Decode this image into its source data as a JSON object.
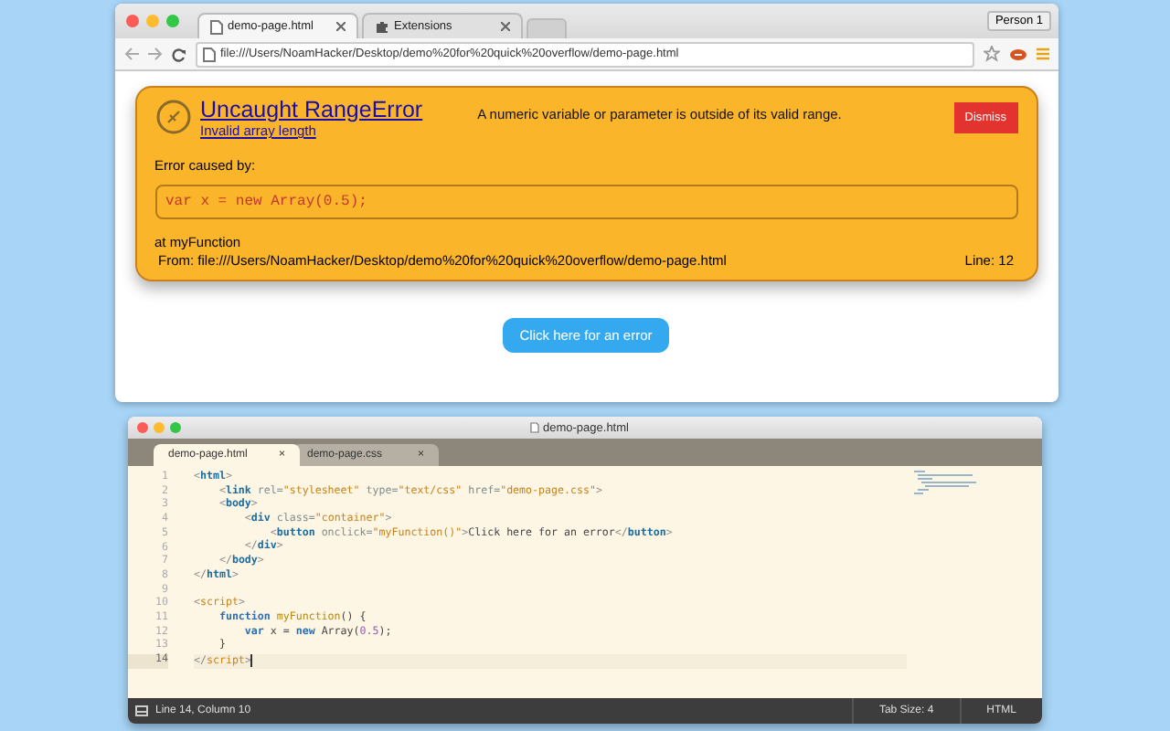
{
  "browser": {
    "tabs": [
      {
        "label": "demo-page.html",
        "selected": true
      },
      {
        "label": "Extensions",
        "selected": false
      }
    ],
    "profile": "Person 1",
    "address": "file:///Users/NoamHacker/Desktop/demo%20for%20quick%20overflow/demo-page.html",
    "error_card": {
      "title": "Uncaught RangeError",
      "subtitle": "Invalid array length",
      "description": "A numeric variable or parameter is outside of its valid range.",
      "dismiss": "Dismiss",
      "caused_label": "Error caused by:",
      "code": "var x = new Array(0.5);",
      "function": "at myFunction",
      "source": "From: file:///Users/NoamHacker/Desktop/demo%20for%20quick%20overflow/demo-page.html",
      "line": "Line: 12"
    },
    "page_button": "Click here for an error"
  },
  "editor": {
    "title": "demo-page.html",
    "tabs": [
      {
        "label": "demo-page.html",
        "close": "×",
        "selected": true
      },
      {
        "label": "demo-page.css",
        "close": "×",
        "selected": false
      }
    ],
    "lines": [
      {
        "number": "1",
        "current": false,
        "tokens": [
          {
            "kind": "punct",
            "text": "<"
          },
          {
            "kind": "tag",
            "text": "html"
          },
          {
            "kind": "punct",
            "text": ">"
          }
        ]
      },
      {
        "number": "2",
        "current": false,
        "tokens": [
          {
            "kind": "punct",
            "text": "    <"
          },
          {
            "kind": "tag",
            "text": "link"
          },
          {
            "kind": "attr",
            "text": " rel="
          },
          {
            "kind": "string",
            "text": "\"stylesheet\""
          },
          {
            "kind": "attr",
            "text": " type="
          },
          {
            "kind": "string",
            "text": "\"text/css\""
          },
          {
            "kind": "attr",
            "text": " href="
          },
          {
            "kind": "string",
            "text": "\"demo-page.css\""
          },
          {
            "kind": "punct",
            "text": ">"
          }
        ]
      },
      {
        "number": "3",
        "current": false,
        "tokens": [
          {
            "kind": "punct",
            "text": "    <"
          },
          {
            "kind": "tag",
            "text": "body"
          },
          {
            "kind": "punct",
            "text": ">"
          }
        ]
      },
      {
        "number": "4",
        "current": false,
        "tokens": [
          {
            "kind": "punct",
            "text": "        <"
          },
          {
            "kind": "tag",
            "text": "div"
          },
          {
            "kind": "attr",
            "text": " class="
          },
          {
            "kind": "string",
            "text": "\"container\""
          },
          {
            "kind": "punct",
            "text": ">"
          }
        ]
      },
      {
        "number": "5",
        "current": false,
        "tokens": [
          {
            "kind": "punct",
            "text": "            <"
          },
          {
            "kind": "tag",
            "text": "button"
          },
          {
            "kind": "attr",
            "text": " onclick="
          },
          {
            "kind": "string",
            "text": "\"myFunction()\""
          },
          {
            "kind": "punct",
            "text": ">"
          },
          {
            "kind": "text",
            "text": "Click here for an error"
          },
          {
            "kind": "punct",
            "text": "</"
          },
          {
            "kind": "tag",
            "text": "button"
          },
          {
            "kind": "punct",
            "text": ">"
          }
        ]
      },
      {
        "number": "6",
        "current": false,
        "tokens": [
          {
            "kind": "punct",
            "text": "        </"
          },
          {
            "kind": "tag",
            "text": "div"
          },
          {
            "kind": "punct",
            "text": ">"
          }
        ]
      },
      {
        "number": "7",
        "current": false,
        "tokens": [
          {
            "kind": "punct",
            "text": "    </"
          },
          {
            "kind": "tag",
            "text": "body"
          },
          {
            "kind": "punct",
            "text": ">"
          }
        ]
      },
      {
        "number": "8",
        "current": false,
        "tokens": [
          {
            "kind": "punct",
            "text": "</"
          },
          {
            "kind": "tag",
            "text": "html"
          },
          {
            "kind": "punct",
            "text": ">"
          }
        ]
      },
      {
        "number": "9",
        "current": false
      },
      {
        "number": "10",
        "current": false,
        "tokens": [
          {
            "kind": "punct",
            "text": "<"
          },
          {
            "kind": "string",
            "text": "script"
          },
          {
            "kind": "punct",
            "text": ">"
          }
        ]
      },
      {
        "number": "11",
        "current": false,
        "tokens": [
          {
            "kind": "keyword",
            "text": "    function"
          },
          {
            "kind": "func",
            "text": " myFunction"
          },
          {
            "kind": "text",
            "text": "() {"
          }
        ]
      },
      {
        "number": "12",
        "current": false,
        "tokens": [
          {
            "kind": "keyword",
            "text": "        var"
          },
          {
            "kind": "text",
            "text": " x = "
          },
          {
            "kind": "keyword",
            "text": "new"
          },
          {
            "kind": "text",
            "text": " Array("
          },
          {
            "kind": "number",
            "text": "0.5"
          },
          {
            "kind": "text",
            "text": ");"
          }
        ]
      },
      {
        "number": "13",
        "current": false,
        "tokens": [
          {
            "kind": "text",
            "text": "    }"
          }
        ]
      },
      {
        "number": "14",
        "current": true,
        "tokens": [
          {
            "kind": "punct",
            "text": "</"
          },
          {
            "kind": "string",
            "text": "script"
          },
          {
            "kind": "punct",
            "text": ">"
          }
        ]
      }
    ],
    "status": {
      "position": "Line 14, Column 10",
      "tab_size": "Tab Size: 4",
      "syntax": "HTML"
    }
  }
}
